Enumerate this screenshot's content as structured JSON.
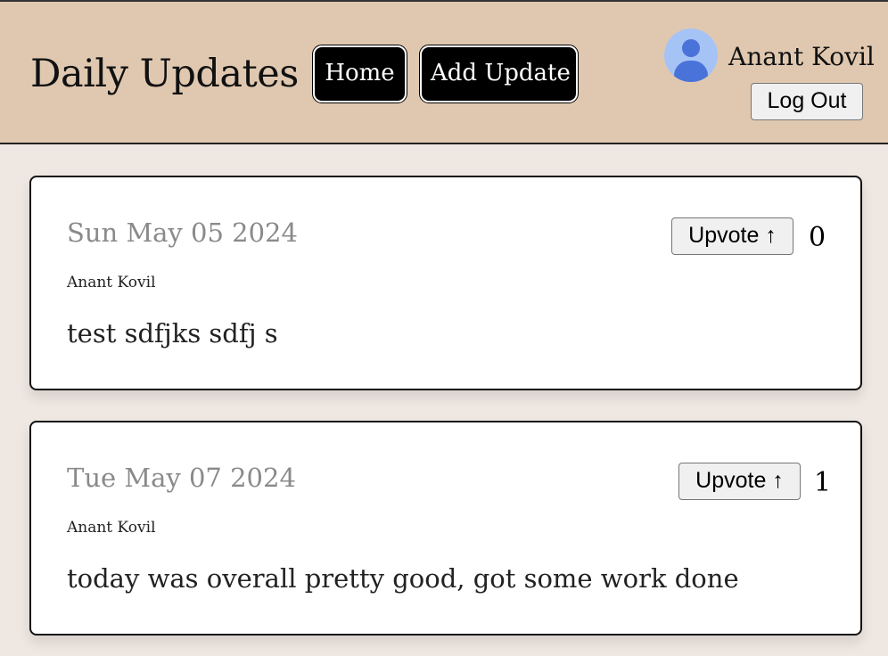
{
  "header": {
    "title": "Daily Updates",
    "nav": {
      "home_label": "Home",
      "add_update_label": "Add Update"
    },
    "user": {
      "name": "Anant Kovil",
      "avatar_icon": "user-avatar-icon",
      "logout_label": "Log Out"
    }
  },
  "colors": {
    "header_bg": "#e0c8b0",
    "page_bg": "#efe7e1",
    "nav_button_bg": "#000000",
    "avatar_bg": "#a6c3f5",
    "avatar_fg": "#4a73d9"
  },
  "updates": [
    {
      "date": "Sun May 05 2024",
      "author": "Anant Kovil",
      "text": "test sdfjks sdfj s",
      "upvote_label": "Upvote ↑",
      "votes": "0"
    },
    {
      "date": "Tue May 07 2024",
      "author": "Anant Kovil",
      "text": "today was overall pretty good, got some work done",
      "upvote_label": "Upvote ↑",
      "votes": "1"
    }
  ]
}
